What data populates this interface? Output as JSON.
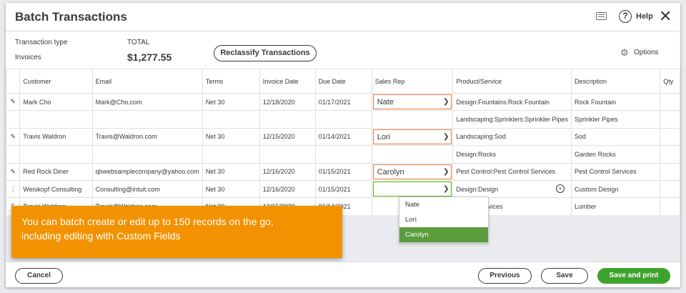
{
  "header": {
    "title": "Batch Transactions",
    "help_label": "Help"
  },
  "summary": {
    "transaction_type_label": "Transaction type",
    "transaction_type_value": "Invoices",
    "total_label": "TOTAL",
    "total_value": "$1,277.55",
    "reclassify_label": "Reclassify Transactions",
    "options_label": "Options"
  },
  "table": {
    "columns": [
      "Customer",
      "Email",
      "Terms",
      "Invoice Date",
      "Due Date",
      "Sales Rep",
      "Product/Service",
      "Description",
      "Qty"
    ],
    "rows": [
      {
        "marker": "✎",
        "customer": "Mark Cho",
        "email": "Mark@Cho.com",
        "terms": "Net 30",
        "invoice_date": "12/18/2020",
        "due_date": "01/17/2021",
        "sales_rep": "Nate",
        "product": "Design:Fountains:Rock Fountain",
        "description": "Rock Fountain",
        "qty": ""
      },
      {
        "marker": "",
        "customer": "",
        "email": "",
        "terms": "",
        "invoice_date": "",
        "due_date": "",
        "sales_rep": "",
        "product": "Landscaping:Sprinklers:Sprinkler Pipes",
        "description": "Sprinkler Pipes",
        "qty": ""
      },
      {
        "marker": "✎",
        "customer": "Travis Waldron",
        "email": "Travis@Waldron.com",
        "terms": "Net 30",
        "invoice_date": "12/15/2020",
        "due_date": "01/14/2021",
        "sales_rep": "Lori",
        "product": "Landscaping:Sod",
        "description": "Sod",
        "qty": ""
      },
      {
        "marker": "",
        "customer": "",
        "email": "",
        "terms": "",
        "invoice_date": "",
        "due_date": "",
        "sales_rep": "",
        "product": "Design:Rocks",
        "description": "Garden Rocks",
        "qty": ""
      },
      {
        "marker": "✎",
        "customer": "Red Rock Diner",
        "email": "qbwebsamplecompany@yahoo.com",
        "terms": "Net 30",
        "invoice_date": "12/16/2020",
        "due_date": "01/15/2021",
        "sales_rep": "Carolyn",
        "product": "Pest Control:Pest Control Services",
        "description": "Pest Control Services",
        "qty": ""
      },
      {
        "marker": "⋮",
        "customer": "Weiskopf Consulting",
        "email": "Consulting@intuit.com",
        "terms": "Net 30",
        "invoice_date": "12/16/2020",
        "due_date": "01/15/2021",
        "sales_rep": "",
        "product": "Design:Design",
        "description": "Custom Design",
        "qty": ""
      },
      {
        "marker": "5",
        "customer": "Travis Waldron",
        "email": "Travis@Waldron.com",
        "terms": "Net 30",
        "invoice_date": "12/15/2020",
        "due_date": "01/14/2021",
        "sales_rep": "",
        "product": "Design:Services",
        "description": "Lumber",
        "qty": ""
      }
    ]
  },
  "dropdown": {
    "options": [
      "Nate",
      "Lori",
      "Carolyn"
    ],
    "selected": "Carolyn"
  },
  "callout": {
    "text_line1": "You can batch create or edit up to 150 records on the go,",
    "text_line2": "including editing with Custom Fields"
  },
  "footer": {
    "cancel_label": "Cancel",
    "previous_label": "Previous",
    "save_label": "Save",
    "save_print_label": "Save and print"
  },
  "colors": {
    "accent_orange": "#f39200",
    "primary_green": "#3ea22e",
    "selected_green": "#5b9d3d",
    "active_border": "#e07a3f",
    "focus_border": "#53b700"
  }
}
